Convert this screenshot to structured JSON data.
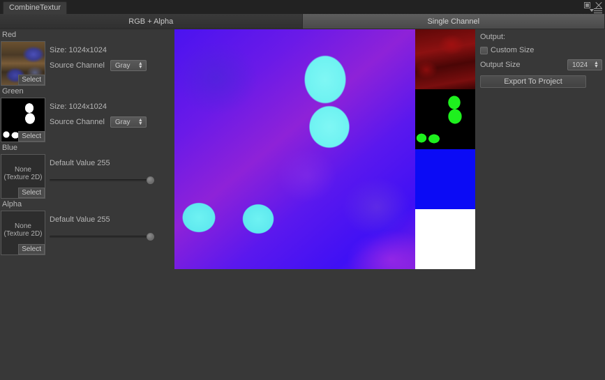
{
  "window": {
    "tab_title": "CombineTextur",
    "maximize_icon": "maximize-icon",
    "close_icon": "close-icon",
    "menu_icon": "window-menu-icon"
  },
  "tabs": [
    {
      "label": "RGB + Alpha",
      "active": true
    },
    {
      "label": "Single Channel",
      "active": false
    }
  ],
  "channels": [
    {
      "name": "Red",
      "has_texture": true,
      "thumb_select_label": "Select",
      "size_label": "Size: 1024x1024",
      "source_channel_label": "Source Channel",
      "source_channel_value": "Gray"
    },
    {
      "name": "Green",
      "has_texture": true,
      "thumb_select_label": "Select",
      "size_label": "Size: 1024x1024",
      "source_channel_label": "Source Channel",
      "source_channel_value": "Gray"
    },
    {
      "name": "Blue",
      "has_texture": false,
      "thumb_none_label": "None (Texture 2D)",
      "thumb_select_label": "Select",
      "default_value_label": "Default Value 255",
      "default_value": 255
    },
    {
      "name": "Alpha",
      "has_texture": false,
      "thumb_none_label": "None (Texture 2D)",
      "thumb_select_label": "Select",
      "default_value_label": "Default Value 255",
      "default_value": 255
    }
  ],
  "preview": {
    "combined_name": "combined-rgba-preview",
    "strips": [
      {
        "name": "red-channel-preview"
      },
      {
        "name": "green-channel-preview"
      },
      {
        "name": "blue-channel-preview"
      },
      {
        "name": "alpha-channel-preview"
      }
    ]
  },
  "output": {
    "heading": "Output:",
    "custom_size_label": "Custom Size",
    "custom_size_checked": false,
    "output_size_label": "Output Size",
    "output_size_value": "1024",
    "export_label": "Export To Project"
  },
  "colors": {
    "window_bg": "#383838",
    "titlebar_bg": "#222222",
    "text": "#b6b6b6",
    "red_channel": "#8c1111",
    "green_channel": "#1ef01e",
    "blue_channel": "#0b0bf5",
    "alpha_channel": "#ffffff"
  }
}
